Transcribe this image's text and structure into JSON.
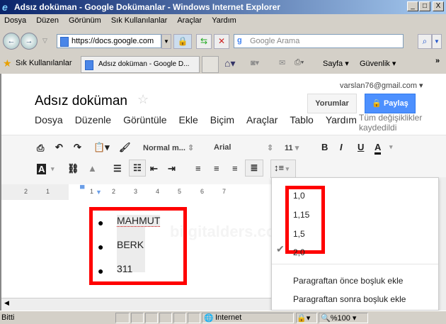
{
  "window": {
    "title": "Adsız doküman - Google Dokümanlar - Windows Internet Explorer",
    "controls": [
      "_",
      "□",
      "X"
    ]
  },
  "ie_menu": [
    "Dosya",
    "Düzen",
    "Görünüm",
    "Sık Kullanılanlar",
    "Araçlar",
    "Yardım"
  ],
  "address": {
    "url": "https://docs.google.com",
    "search_placeholder": "Google Arama"
  },
  "favorites": {
    "label": "Sık Kullanılanlar",
    "tab": "Adsız doküman - Google D...",
    "page": "Sayfa",
    "security": "Güvenlik"
  },
  "docs": {
    "account": "varslan76@gmail.com",
    "title": "Adsız doküman",
    "comments_button": "Yorumlar",
    "share_button": "Paylaş",
    "menu": [
      "Dosya",
      "Düzenle",
      "Görüntüle",
      "Ekle",
      "Biçim",
      "Araçlar",
      "Tablo",
      "Yardım"
    ],
    "save_status": "Tüm değişiklikler kaydedildi",
    "style_select": "Normal m...",
    "font_select": "Arial",
    "font_size": "11",
    "ruler_labels": [
      "2",
      "1",
      "1",
      "2",
      "3",
      "4",
      "5",
      "6",
      "7"
    ],
    "list_items": [
      "MAHMUT",
      "BERK",
      "311"
    ],
    "watermark": "bilgitalders.com"
  },
  "line_spacing_menu": {
    "options": [
      "1,0",
      "1,15",
      "1,5",
      "2,0"
    ],
    "selected": "2,0",
    "actions": [
      "Paragraftan önce boşluk ekle",
      "Paragraftan sonra boşluk ekle"
    ]
  },
  "status": {
    "text": "Bitti",
    "zone": "Internet",
    "zoom": "%100"
  },
  "colors": {
    "share": "#4d90fe",
    "highlight_box": "#ff0000",
    "title_bar": "#0a246a"
  }
}
